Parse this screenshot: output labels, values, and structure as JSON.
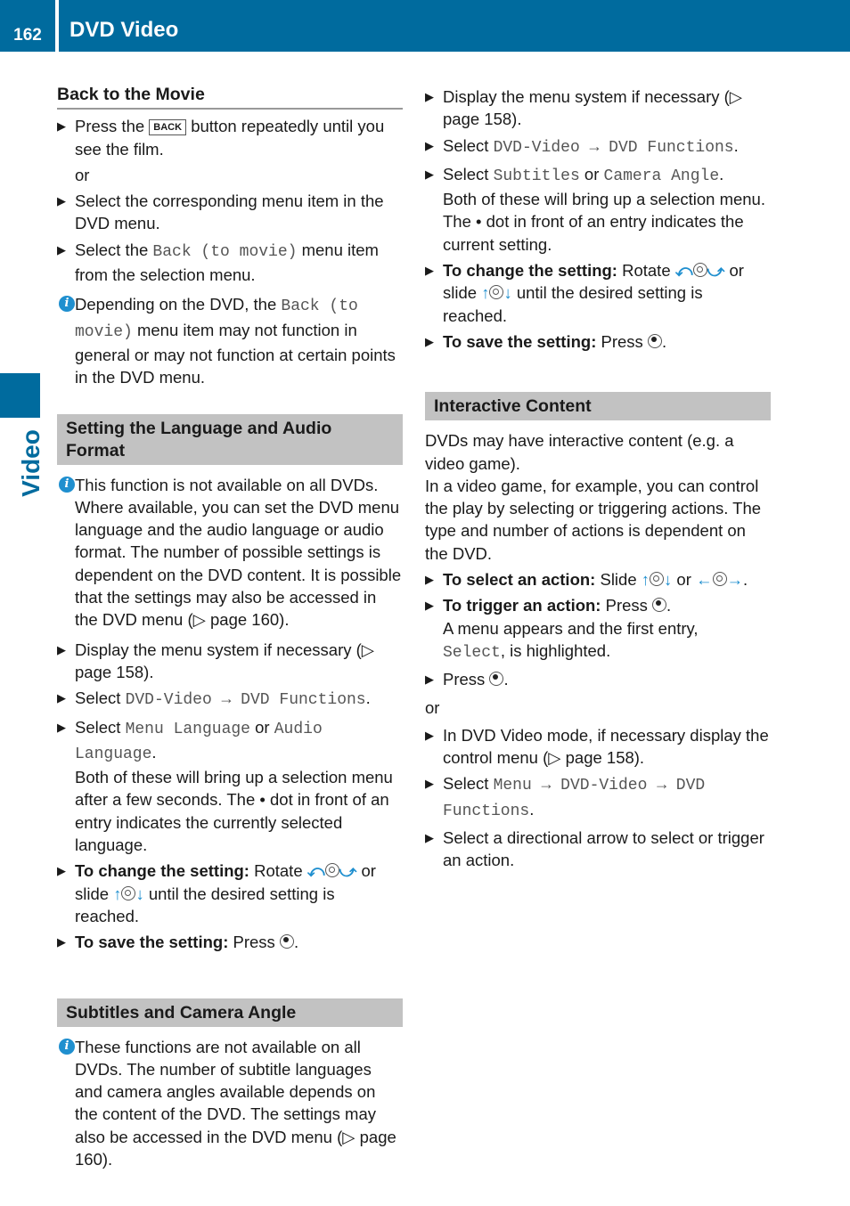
{
  "header": {
    "page_number": "162",
    "title": "DVD Video"
  },
  "side_tab": {
    "label": "Video"
  },
  "colors": {
    "brand": "#006b9e",
    "section_bg": "#c2c2c2",
    "info_icon": "#1f8fcf"
  },
  "back_to_movie": {
    "title": "Back to the Movie",
    "s1a": "Press the",
    "back_btn": "BACK",
    "s1b": "button repeatedly until you see the film.",
    "or": "or",
    "s2": "Select the corresponding menu item in the DVD menu.",
    "s3a": "Select the",
    "s3m": "Back (to movie)",
    "s3b": "menu item from the selection menu.",
    "info_a": "Depending on the DVD, the",
    "info_m": "Back (to movie)",
    "info_b": "menu item may not function in general or may not function at certain points in the DVD menu."
  },
  "language": {
    "title": "Setting the Language and Audio Format",
    "info": "This function is not available on all DVDs. Where available, you can set the DVD menu language and the audio language or audio format. The number of possible settings is dependent on the DVD content. It is possible that the settings may also be accessed in the DVD menu (▷ page 160).",
    "s1": "Display the menu system if necessary (▷ page 158).",
    "s2a": "Select",
    "s2m": "DVD-Video → DVD Functions",
    "dot": ".",
    "s3a": "Select",
    "s3m1": "Menu Language",
    "s3or": "or",
    "s3m2": "Audio Language",
    "s3b": "Both of these will bring up a selection menu after a few seconds. The • dot in front of an entry indicates the currently selected language.",
    "s4b": "To change the setting:",
    "s4a": "Rotate",
    "s4or": "or slide",
    "s4c": "until the desired setting is reached.",
    "s5b": "To save the setting:",
    "s5a": "Press"
  },
  "subtitles": {
    "title": "Subtitles and Camera Angle",
    "info": "These functions are not available on all DVDs. The number of subtitle languages and camera angles available depends on the content of the DVD. The settings may also be accessed in the DVD menu (▷ page 160).",
    "s1": "Display the menu system if necessary (▷ page 158).",
    "s2a": "Select",
    "s2m": "DVD-Video → DVD Functions",
    "s3a": "Select",
    "s3m1": "Subtitles",
    "s3or": "or",
    "s3m2": "Camera Angle",
    "s3b": "Both of these will bring up a selection menu. The • dot in front of an entry indicates the current setting.",
    "s4b": "To change the setting:",
    "s4a": "Rotate",
    "s4or": "or slide",
    "s4c": "until the desired setting is reached.",
    "s5b": "To save the setting:",
    "s5a": "Press"
  },
  "interactive": {
    "title": "Interactive Content",
    "p1": "DVDs may have interactive content (e.g. a video game).",
    "p2": "In a video game, for example, you can control the play by selecting or triggering actions. The type and number of actions is dependent on the DVD.",
    "s1b": "To select an action:",
    "s1a": "Slide",
    "s1or": "or",
    "s2b": "To trigger an action:",
    "s2a": "Press",
    "s2c": "A menu appears and the first entry,",
    "s2m": "Select",
    "s2d": ", is highlighted.",
    "s3": "Press",
    "or": "or",
    "s4": "In DVD Video mode, if necessary display the control menu (▷ page 158).",
    "s5a": "Select",
    "s5m": "Menu → DVD-Video → DVD Functions",
    "s6": "Select a directional arrow to select or trigger an action."
  }
}
